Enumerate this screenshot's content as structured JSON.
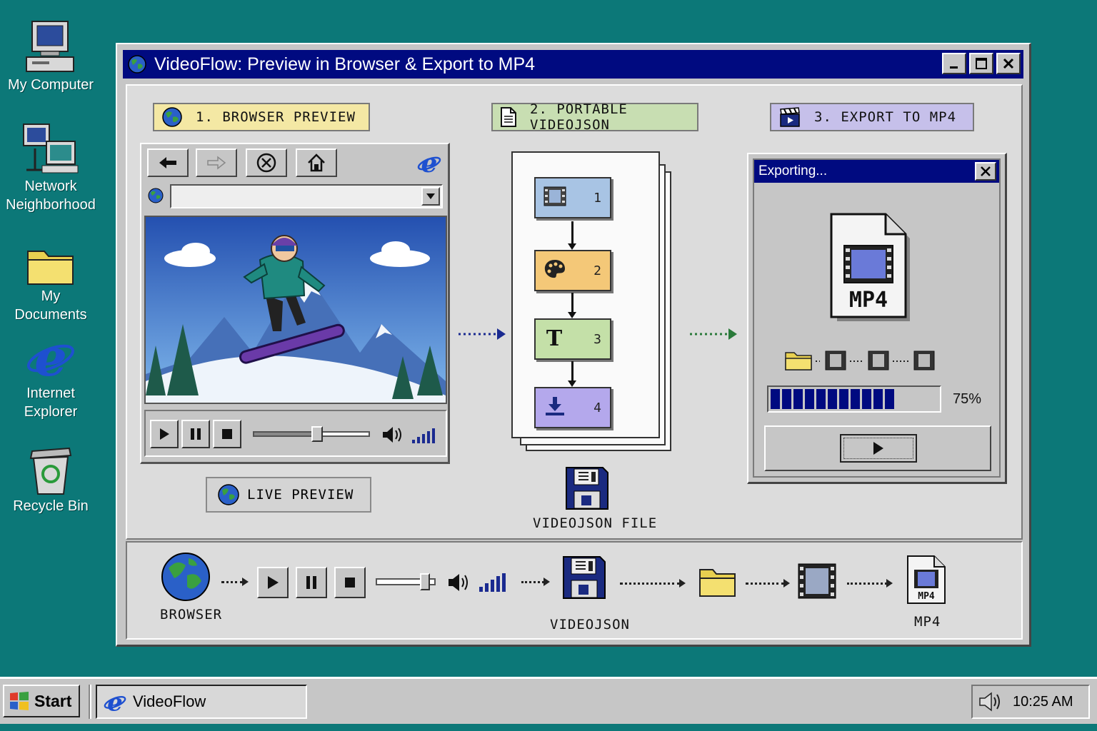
{
  "desktop": {
    "icons": [
      {
        "label": "My Computer",
        "icon": "computer-icon"
      },
      {
        "label": "Network Neighborhood",
        "icon": "network-icon"
      },
      {
        "label": "My Documents",
        "icon": "folder-icon"
      },
      {
        "label": "Internet Explorer",
        "icon": "ie-icon"
      },
      {
        "label": "Recycle Bin",
        "icon": "recycle-bin-icon"
      }
    ]
  },
  "window": {
    "title": "VideoFlow: Preview in Browser & Export to MP4"
  },
  "steps": [
    {
      "label": "1. BROWSER PREVIEW",
      "color": "#f4e8a4"
    },
    {
      "label": "2. PORTABLE VIDEOJSON",
      "color": "#c8deb2"
    },
    {
      "label": "3. EXPORT TO MP4",
      "color": "#c6c0ea"
    }
  ],
  "browser": {
    "url": "",
    "live_preview_label": "LIVE PREVIEW"
  },
  "pipeline": {
    "steps": [
      {
        "num": "1",
        "icon": "film-icon",
        "color": "#a8c4e4"
      },
      {
        "num": "2",
        "icon": "palette-icon",
        "color": "#f4c878"
      },
      {
        "num": "3",
        "icon": "text-icon",
        "color": "#c4e0a8"
      },
      {
        "num": "4",
        "icon": "download-icon",
        "color": "#b4a8ec"
      }
    ],
    "file_label": "VIDEOJSON FILE"
  },
  "export_dialog": {
    "title": "Exporting...",
    "file_type": "MP4",
    "progress_percent": 75,
    "progress_text": "75%"
  },
  "bottom_flow": {
    "browser_label": "BROWSER",
    "videojson_label": "VIDEOJSON",
    "mp4_label": "MP4",
    "mp4_icon_text": "MP4"
  },
  "taskbar": {
    "start_label": "Start",
    "task_label": "VideoFlow",
    "clock": "10:25 AM"
  }
}
